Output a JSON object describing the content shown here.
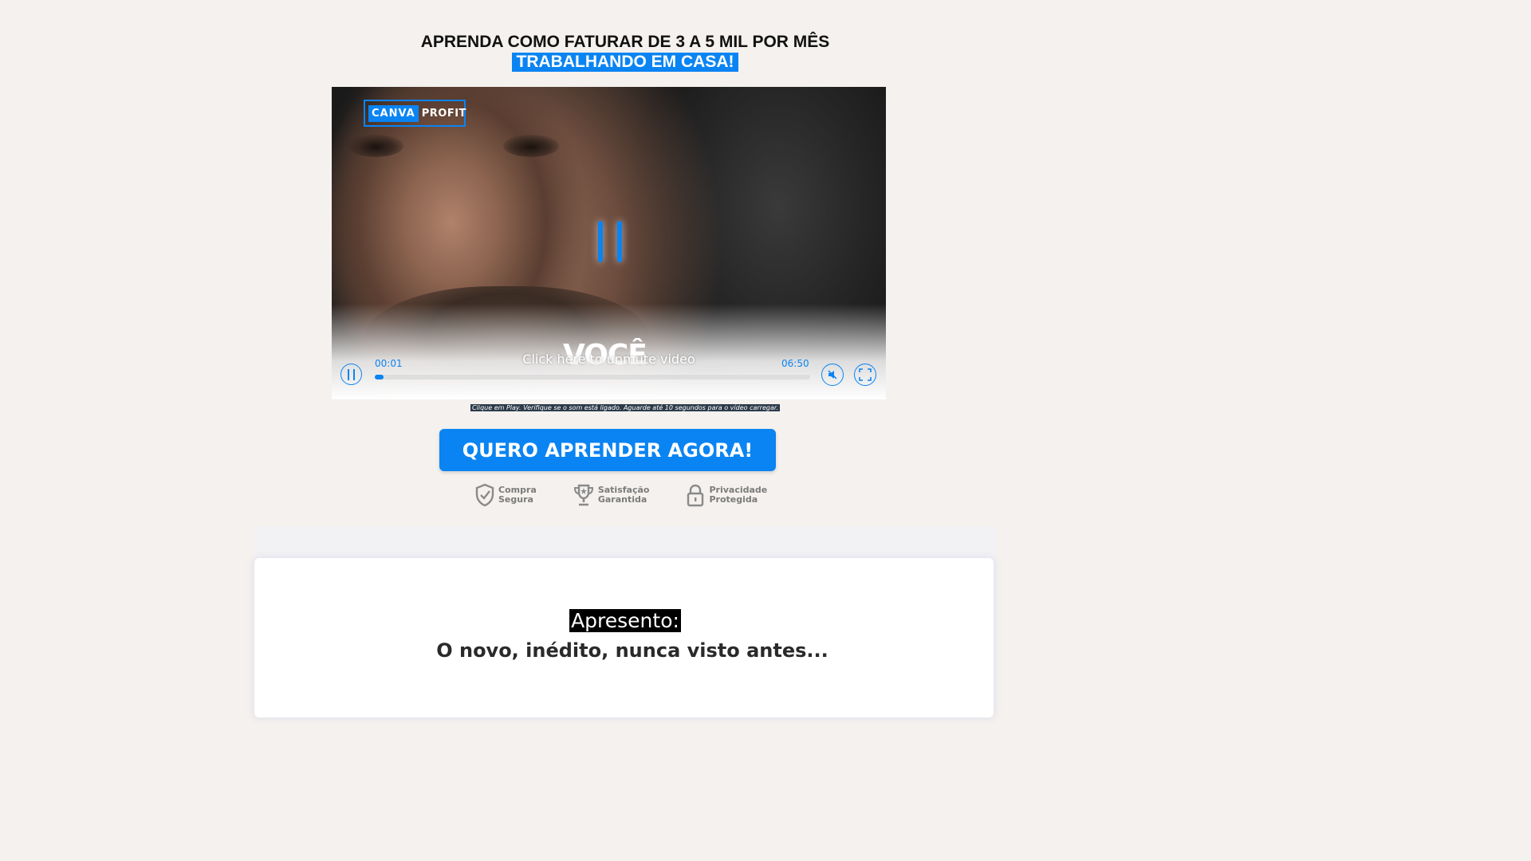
{
  "headline": {
    "line1": "APRENDA COMO FATURAR DE 3 A 5 MIL POR MÊS",
    "line2": "TRABALHANDO EM CASA!"
  },
  "video": {
    "logo_left": "CANVA",
    "logo_right": "PROFIT",
    "overlay_word": "VOCÊ",
    "unmute_text": "Click here to unmute video",
    "current_time": "00:01",
    "duration": "06:50",
    "progress_fraction": 0.0025
  },
  "caption": "Clique em Play. Verifique se o som está ligado. Aguarde até 10 segundos para o vídeo carregar.",
  "cta_label": "QUERO APRENDER AGORA!",
  "badges": [
    {
      "line1": "Compra",
      "line2": "Segura",
      "icon": "shield-check-icon"
    },
    {
      "line1": "Satisfação",
      "line2": "Garantida",
      "icon": "trophy-icon"
    },
    {
      "line1": "Privacidade",
      "line2": "Protegida",
      "icon": "padlock-icon"
    }
  ],
  "section": {
    "label": "Apresento:",
    "subtitle": "O novo, inédito, nunca visto antes..."
  },
  "colors": {
    "accent": "#0a84f3",
    "page_bg": "#f4f1ee"
  }
}
